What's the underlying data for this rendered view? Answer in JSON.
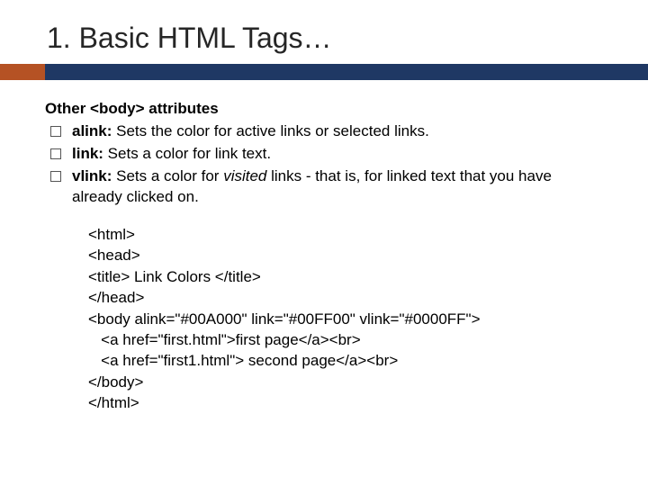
{
  "title": "1. Basic HTML Tags…",
  "sectionHeading": "Other <body> attributes",
  "bullets": [
    {
      "label": "alink:",
      "text": " Sets the color for active links or selected links."
    },
    {
      "label": "link:",
      "text": " Sets a color for link text."
    },
    {
      "label": "vlink:",
      "textPre": " Sets a color for ",
      "italic": "visited",
      "textPost": " links - that is, for linked text that you have already clicked on."
    }
  ],
  "code": {
    "l1": "<html>",
    "l2": "<head>",
    "l3": "<title> Link Colors </title>",
    "l4": "</head>",
    "l5": "<body alink=\"#00A000\" link=\"#00FF00\" vlink=\"#0000FF\">",
    "l6": "   <a href=\"first.html\">first page</a><br>",
    "l7": "   <a href=\"first1.html\"> second page</a><br>",
    "l8": "</body>",
    "l9": "</html>"
  }
}
